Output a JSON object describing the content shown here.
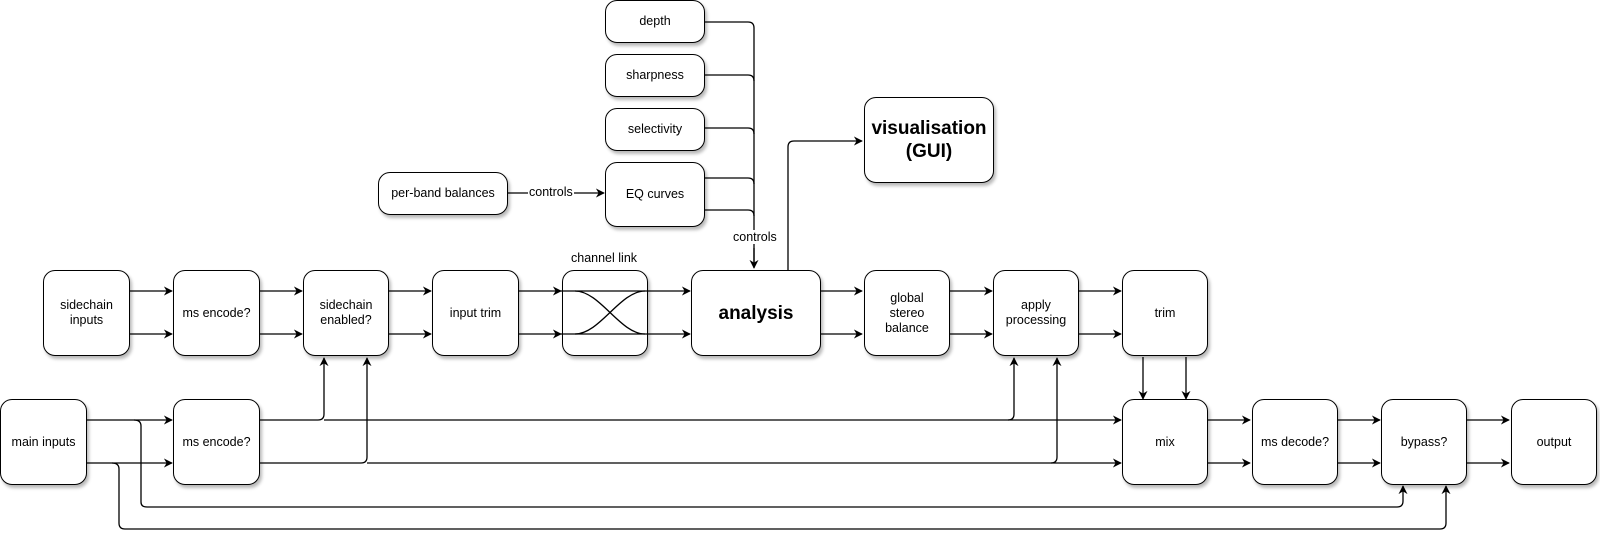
{
  "nodes": {
    "depth": "depth",
    "sharpness": "sharpness",
    "selectivity": "selectivity",
    "eq_curves": "EQ curves",
    "per_band_balances": "per-band balances",
    "visualisation": "visualisation\n(GUI)",
    "sidechain_inputs": "sidechain\ninputs",
    "sc_ms_encode": "ms encode?",
    "sidechain_enabled": "sidechain\nenabled?",
    "input_trim": "input trim",
    "channel_link": "",
    "analysis": "analysis",
    "global_stereo_balance": "global\nstereo\nbalance",
    "apply_processing": "apply\nprocessing",
    "trim": "trim",
    "main_inputs": "main inputs",
    "main_ms_encode": "ms encode?",
    "mix": "mix",
    "ms_decode": "ms decode?",
    "bypass": "bypass?",
    "output": "output"
  },
  "labels": {
    "channel_link": "channel link",
    "controls_eq": "controls",
    "controls_analysis": "controls"
  }
}
